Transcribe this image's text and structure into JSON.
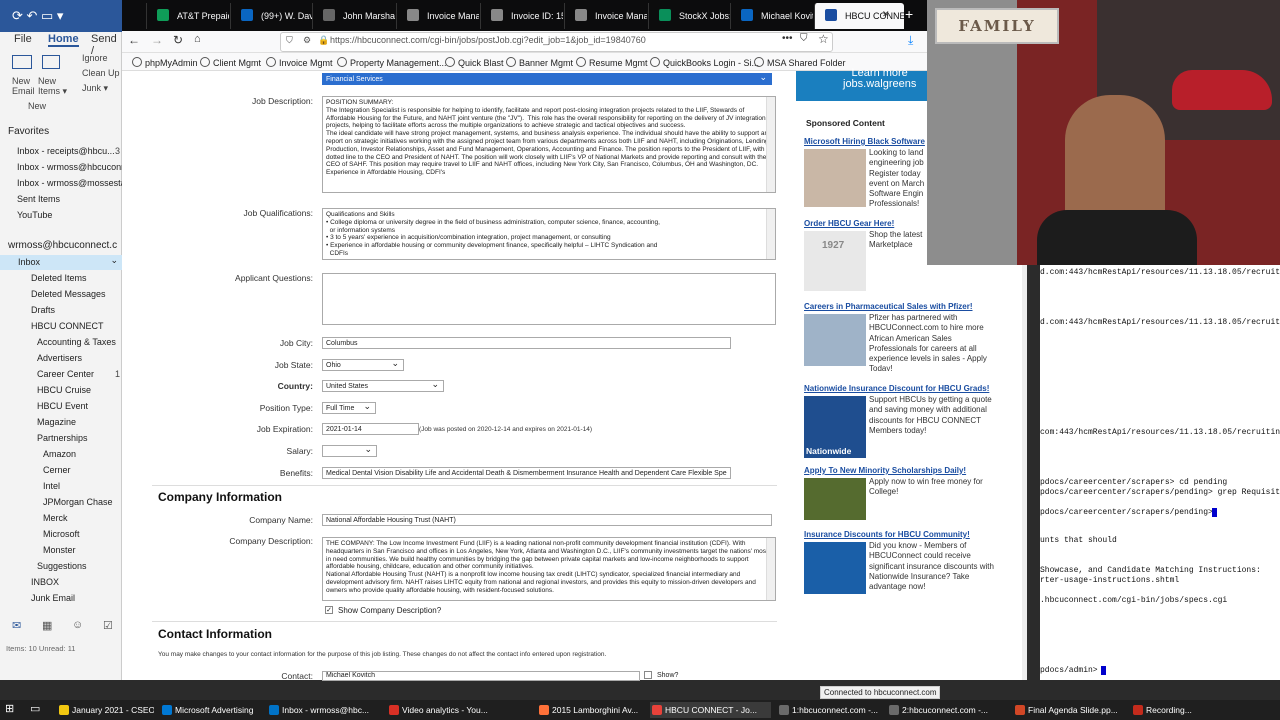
{
  "outlook": {
    "title": "⟳ ↶ ▭ ▾",
    "tabs": [
      "File",
      "Home",
      "Send /"
    ],
    "ribbon": {
      "new_email": "New Email",
      "new_items": "New Items ▾",
      "new_group": "New",
      "ignore": "Ignore",
      "cleanup": "Clean Up",
      "junk": "Junk ▾"
    },
    "favorites_header": "Favorites",
    "favorites": [
      "Inbox - receipts@hbcu...",
      "Inbox - wrmoss@hbcuconn...",
      "Inbox - wrmoss@mossestate...",
      "Sent Items",
      "YouTube"
    ],
    "account": "wrmoss@hbcuconnect.c",
    "folders": [
      "Inbox",
      "Deleted Items",
      "Deleted Messages",
      "Drafts",
      "HBCU CONNECT",
      "Accounting & Taxes",
      "Advertisers",
      "Career Center",
      "HBCU Cruise",
      "HBCU Event",
      "Magazine",
      "Partnerships",
      "Amazon",
      "Cerner",
      "Intel",
      "JPMorgan Chase",
      "Merck",
      "Microsoft",
      "Monster",
      "Suggestions",
      "INBOX",
      "Junk Email"
    ],
    "counts": {
      "fav1": "3",
      "career": "1"
    },
    "status": "Items: 10   Unread: 11"
  },
  "browser": {
    "tabs": [
      "AT&T Prepaid A",
      "(99+) W. David",
      "John Marshall (S3",
      "Invoice Manager -",
      "Invoice ID: 15884 -",
      "Invoice Manager -",
      "StockX Jobs: Vi",
      "Michael Kovitch (Li",
      "HBCU CONNEC"
    ],
    "url": "https://hbcuconnect.com/cgi-bin/jobs/postJob.cgi?edit_job=1&job_id=19840760",
    "bookmarks": [
      "phpMyAdmin",
      "Client Mgmt",
      "Invoice Mgmt",
      "Property Management...",
      "Quick Blast",
      "Banner Mgmt",
      "Resume Mgmt",
      "QuickBooks Login - Si...",
      "MSA Shared Folder"
    ],
    "status": "Connected to hbcuconnect.com"
  },
  "form": {
    "category_value": "Financial Services",
    "job_description_label": "Job Description:",
    "job_description": "POSITION SUMMARY:\nThe Integration Specialist is responsible for helping to identify, facilitate and report post-closing integration projects related to the LIIF, Stewards of Affordable Housing for the Future, and NAHT joint venture (the \"JV\").  This role has the overall responsibility for reporting on the delivery of JV integration projects, helping to facilitate efforts across the multiple organizations to achieve strategic and tactical objectives and success.\nThe ideal candidate will have strong project management, systems, and business analysis experience. The individual should have the ability to support and report on strategic initiatives working with the assigned project team from various departments across both LIIF and NAHT, including Originations, Lending Production, Investor Relationships, Asset and Fund Management, Operations, Accounting and Finance. The position reports to the President of LIIF, with a dotted line to the CEO and President of NAHT. The position will work closely with LIIF's VP of National Markets and provide reporting and consult with the CEO of SAHF. This position may require travel to LIIF and NAHT offices, including New York City, San Francisco, Columbus, OH and Washington, DC.  Experience in Affordable Housing, CDFI's",
    "job_qualifications_label": "Job Qualifications:",
    "job_qualifications": "Qualifications and Skills\n• College diploma or university degree in the field of business administration, computer science, finance, accounting,\n  or information systems\n• 3 to 5 years' experience in acquisition/combination integration, project management, or consulting\n• Experience in affordable housing or community development finance, specifically helpful – LIHTC Syndication and\n  CDFIs",
    "applicant_questions_label": "Applicant Questions:",
    "job_city_label": "Job City:",
    "job_city": "Columbus",
    "job_state_label": "Job State:",
    "job_state": "Ohio",
    "country_label": "Country:",
    "country": "United States",
    "position_type_label": "Position Type:",
    "position_type": "Full Time",
    "job_expiration_label": "Job Expiration:",
    "job_expiration": "2021-01-14",
    "expiration_note": "(Job was posted on 2020-12-14 and expires on 2021-01-14)",
    "salary_label": "Salary:",
    "benefits_label": "Benefits:",
    "benefits": "Medical Dental Vision Disability Life and Accidental Death & Dismemberment Insurance Health and Dependent Care Flexible Spe",
    "company_info_header": "Company Information",
    "company_name_label": "Company Name:",
    "company_name": "National Affordable Housing Trust (NAHT)",
    "company_description_label": "Company Description:",
    "company_description": "THE COMPANY: The Low Income Investment Fund (LIIF) is a leading national non-profit community development financial institution (CDFI). With headquarters in San Francisco and offices in Los Angeles, New York, Atlanta and Washington D.C., LIIF's community investments target the nations' most in need communities. We build healthy communities by bridging the gap between private capital markets and low-income neighborhoods to support affordable housing, childcare, education and other community initiatives.\nNational Affordable Housing Trust (NAHT) is a nonprofit low income housing tax credit (LIHTC) syndicator, specialized financial intermediary and development advisory firm. NAHT raises LIHTC equity from national and regional investors, and provides this equity to mission-driven developers and owners who provide quality affordable housing, with resident-focused solutions.",
    "show_company_desc": "Show Company Description?",
    "contact_info_header": "Contact Information",
    "contact_note": "You may make changes to your contact information for the purpose of this job listing. These changes do not affect the contact info entered upon registration.",
    "contact_label": "Contact:",
    "contact": "Michael Kovitch",
    "show_label": "Show?"
  },
  "ads": {
    "banner": "Learn more\njobs.walgreens",
    "header": "Sponsored Content",
    "items": [
      {
        "title": "Microsoft Hiring Black Software",
        "body": "Looking to land engineering job Register today event on March Software Engin Professionals!"
      },
      {
        "title": "Order HBCU Gear Here!",
        "body": "Shop the latest Marketplace"
      },
      {
        "title": "Careers in Pharmaceutical Sales with Pfizer!",
        "body": "Pfizer has partnered with HBCUConnect.com to hire more African American Sales Professionals for careers at all experience levels in sales - Apply Today!"
      },
      {
        "title": "Nationwide Insurance Discount for HBCU Grads!",
        "body": "Support HBCUs by getting a quote and saving money with additional discounts for HBCU CONNECT Members today!"
      },
      {
        "title": "Apply To New Minority Scholarships Daily!",
        "body": "Apply now to win free money for College!"
      },
      {
        "title": "Insurance Discounts for HBCU Community!",
        "body": "Did you know - Members of HBCUConnect could receive significant insurance discounts with Nationwide Insurance? Take advantage now!"
      }
    ],
    "nationwide": "Nationwide",
    "shirt": "1927"
  },
  "terminal": {
    "lines": [
      "d.com:443/hcmRestApi/resources/11.13.18.05/recruitin",
      "d.com:443/hcmRestApi/resources/11.13.18.05/recruitin",
      "com:443/hcmRestApi/resources/11.13.18.05/recruiting",
      "pdocs/careercenter/scrapers> cd pending",
      "pdocs/careercenter/scrapers/pending> grep Requisitio",
      "pdocs/careercenter/scrapers/pending>",
      "unts that should",
      "Showcase, and Candidate Matching Instructions:",
      "rter-usage-instructions.shtml",
      ".hbcuconnect.com/cgi-bin/jobs/specs.cgi",
      "pdocs/admin>"
    ]
  },
  "webcam": {
    "sign": "FAMILY"
  },
  "taskbar": {
    "items": [
      "January 2021 - CSEO ...",
      "Microsoft Advertising",
      "Inbox - wrmoss@hbc...",
      "Video analytics - You...",
      "2015 Lamborghini Av...",
      "HBCU CONNECT - Jo...",
      "1:hbcuconnect.com -...",
      "2:hbcuconnect.com -...",
      "Final Agenda Slide.pp...",
      "Recording..."
    ],
    "colors": [
      "#f2c811",
      "#0078d4",
      "#0072c6",
      "#d93025",
      "#ff7139",
      "#e8423a",
      "#6a6a6a",
      "#6a6a6a",
      "#d24726",
      "#c42b1c"
    ]
  }
}
